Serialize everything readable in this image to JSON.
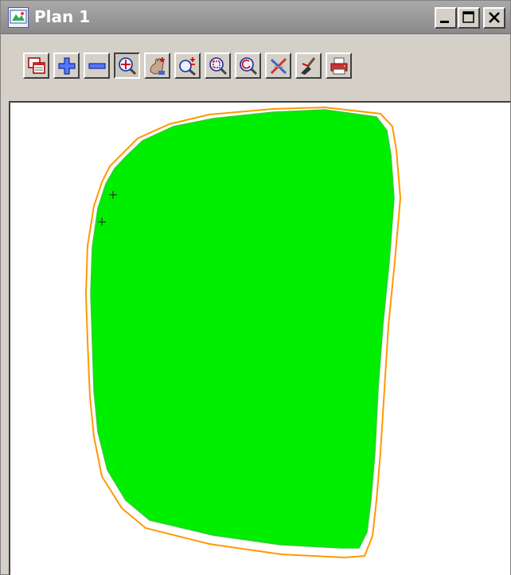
{
  "window": {
    "title": "Plan 1",
    "controls": {
      "minimize_icon": "minimize-icon",
      "maximize_icon": "maximize-icon",
      "close_icon": "close-icon"
    }
  },
  "toolbar": {
    "buttons": [
      {
        "name": "plot-window-button",
        "icon": "plot-windows-icon"
      },
      {
        "name": "zoom-in-button",
        "icon": "plus-icon"
      },
      {
        "name": "zoom-out-button",
        "icon": "minus-icon"
      },
      {
        "name": "zoom-extents-button",
        "icon": "zoom-extents-icon",
        "pressed": true
      },
      {
        "name": "pan-button",
        "icon": "pan-hand-icon"
      },
      {
        "name": "zoom-dynamic-button",
        "icon": "zoom-plus-minus-icon"
      },
      {
        "name": "zoom-window-button",
        "icon": "zoom-window-icon"
      },
      {
        "name": "zoom-previous-button",
        "icon": "zoom-previous-icon"
      },
      {
        "name": "clear-button",
        "icon": "clear-cross-icon"
      },
      {
        "name": "tools-button",
        "icon": "brush-icon"
      },
      {
        "name": "plot-button",
        "icon": "printer-icon"
      }
    ]
  },
  "plan_view": {
    "fill_color": "#00ee00",
    "outer_boundary_color": "#ff9900",
    "inner_boundary_color": "#33cc33",
    "marker_color": "#333333",
    "background_color": "#ffffff"
  }
}
